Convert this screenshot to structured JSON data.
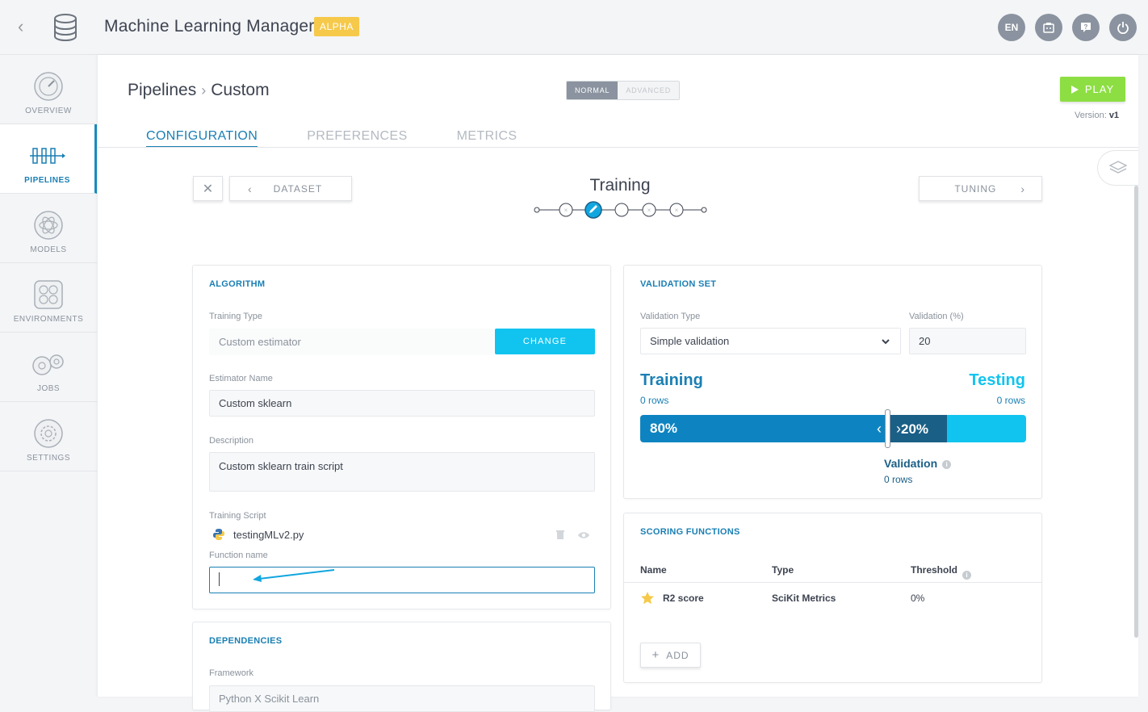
{
  "header": {
    "app_title": "Machine Learning Manager",
    "badge": "ALPHA",
    "lang": "EN",
    "icons": [
      "back-icon",
      "database-icon",
      "language-icon",
      "clipboard-icon",
      "help-icon",
      "power-icon"
    ]
  },
  "sidebar": {
    "items": [
      {
        "label": "OVERVIEW",
        "icon": "gauge-icon",
        "active": false
      },
      {
        "label": "PIPELINES",
        "icon": "pipeline-icon",
        "active": true
      },
      {
        "label": "MODELS",
        "icon": "atom-icon",
        "active": false
      },
      {
        "label": "ENVIRONMENTS",
        "icon": "environment-icon",
        "active": false
      },
      {
        "label": "JOBS",
        "icon": "gears-icon",
        "active": false
      },
      {
        "label": "SETTINGS",
        "icon": "settings-icon",
        "active": false
      }
    ]
  },
  "page": {
    "breadcrumb": [
      "Pipelines",
      "Custom"
    ],
    "mode": {
      "normal": "NORMAL",
      "advanced": "ADVANCED"
    },
    "play_label": "PLAY",
    "version_label": "Version:",
    "version_value": "v1",
    "tabs": [
      "CONFIGURATION",
      "PREFERENCES",
      "METRICS"
    ]
  },
  "steps": {
    "prev_label": "DATASET",
    "next_label": "TUNING",
    "current_title": "Training"
  },
  "algorithm": {
    "title": "ALGORITHM",
    "training_type_label": "Training Type",
    "training_type_value": "Custom estimator",
    "change_label": "CHANGE",
    "estimator_name_label": "Estimator Name",
    "estimator_name_value": "Custom sklearn",
    "description_label": "Description",
    "description_value": "Custom sklearn train script",
    "training_script_label": "Training Script",
    "training_script_file": "testingMLv2.py",
    "function_name_label": "Function name",
    "function_name_value": ""
  },
  "dependencies": {
    "title": "DEPENDENCIES",
    "framework_label": "Framework",
    "framework_value": "Python X Scikit Learn"
  },
  "validation": {
    "title": "VALIDATION SET",
    "type_label": "Validation Type",
    "type_value": "Simple validation",
    "percent_label": "Validation (%)",
    "percent_value": "20",
    "training_heading": "Training",
    "training_rows": "0 rows",
    "testing_heading": "Testing",
    "testing_rows": "0 rows",
    "train_pct_text": "80%",
    "val_pct_text": "20%",
    "validation_heading": "Validation",
    "validation_rows": "0 rows",
    "split": {
      "training_fraction": 0.8
    }
  },
  "scoring": {
    "title": "SCORING FUNCTIONS",
    "columns": [
      "Name",
      "Type",
      "Threshold"
    ],
    "rows": [
      {
        "name": "R2 score",
        "type": "SciKit Metrics",
        "threshold": "0%"
      }
    ],
    "add_label": "ADD"
  },
  "colors": {
    "accent": "#1a7fb4",
    "cyan": "#11c4ef",
    "play": "#8dde43",
    "badge": "#f6c94a"
  }
}
